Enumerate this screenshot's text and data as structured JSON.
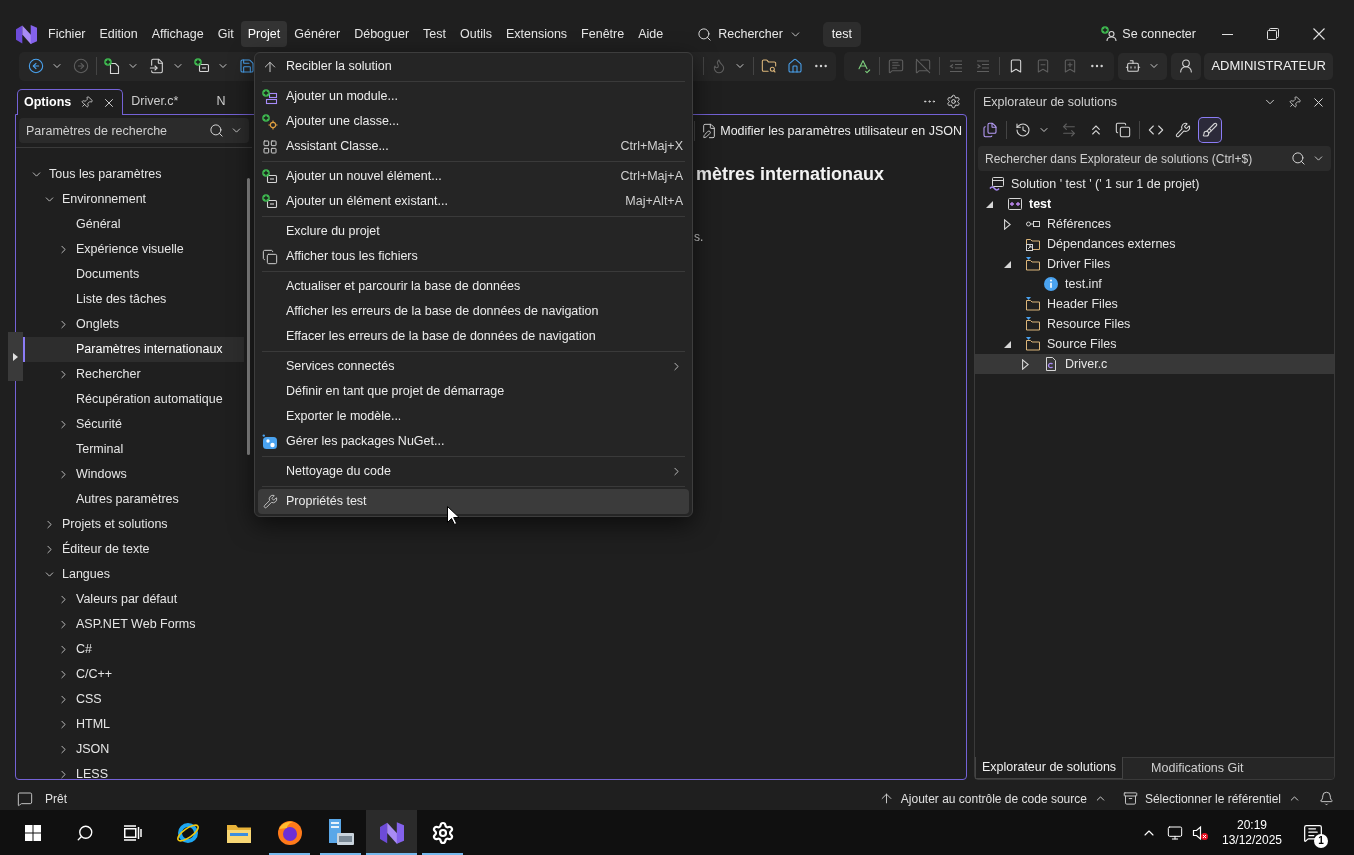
{
  "title_bar": {
    "menu": [
      {
        "label": "Fichier",
        "selected": false
      },
      {
        "label": "Edition",
        "selected": false
      },
      {
        "label": "Affichage",
        "selected": false
      },
      {
        "label": "Git",
        "selected": false
      },
      {
        "label": "Projet",
        "selected": true
      },
      {
        "label": "Générer",
        "selected": false
      },
      {
        "label": "Déboguer",
        "selected": false
      },
      {
        "label": "Test",
        "selected": false
      },
      {
        "label": "Outils",
        "selected": false
      },
      {
        "label": "Extensions",
        "selected": false
      },
      {
        "label": "Fenêtre",
        "selected": false
      },
      {
        "label": "Aide",
        "selected": false
      }
    ],
    "search_button": "Rechercher",
    "solution_badge": "test",
    "sign_in": "Se connecter"
  },
  "toolbar": {
    "main_group": {
      "start": [
        [
          {
            "kind": "back",
            "disabled": false,
            "dropdown": true
          },
          {
            "kind": "forward",
            "disabled": true
          }
        ],
        [
          {
            "kind": "new-project",
            "disabled": false,
            "dropdown": true
          },
          {
            "kind": "open-file",
            "disabled": false,
            "dropdown": true
          },
          {
            "kind": "add-item",
            "disabled": false,
            "dropdown": true
          },
          {
            "kind": "save",
            "disabled": false
          }
        ]
      ],
      "end": [
        [
          {
            "kind": "flame",
            "disabled": true,
            "dropdown": true
          }
        ],
        [
          {
            "kind": "folder-search",
            "disabled": false
          },
          {
            "kind": "home-window",
            "disabled": false
          },
          {
            "kind": "more",
            "disabled": false
          }
        ]
      ]
    },
    "edit_group": [
      [
        {
          "kind": "spell-check",
          "disabled": false
        }
      ],
      [
        {
          "kind": "comment",
          "disabled": true
        },
        {
          "kind": "uncomment",
          "disabled": true
        }
      ],
      [
        {
          "kind": "outdent",
          "disabled": true
        },
        {
          "kind": "indent",
          "disabled": true
        }
      ],
      [
        {
          "kind": "bookmark",
          "disabled": false
        },
        {
          "kind": "bookmark-prev",
          "disabled": true
        },
        {
          "kind": "bookmark-next",
          "disabled": true
        },
        {
          "kind": "more",
          "disabled": false
        }
      ]
    ],
    "extras": [
      {
        "kind": "assistant",
        "dropdown": true
      },
      {
        "kind": "share"
      }
    ],
    "account_button": "ADMINISTRATEUR"
  },
  "options_window": {
    "tabs": [
      {
        "label": "Options",
        "selected": true
      },
      {
        "label": "Driver.c*",
        "selected": false
      },
      {
        "label": "N",
        "selected": false
      }
    ],
    "search": {
      "placeholder": "Paramètres de recherche"
    },
    "tree": [
      {
        "label": "Tous les paramètres",
        "expanded": true,
        "selected": false,
        "children": [
          {
            "label": "Environnement",
            "expanded": true,
            "selected": false,
            "children": [
              {
                "label": "Général",
                "selected": false
              },
              {
                "label": "Expérience visuelle",
                "expanded": false,
                "selected": false
              },
              {
                "label": "Documents",
                "selected": false
              },
              {
                "label": "Liste des tâches",
                "selected": false
              },
              {
                "label": "Onglets",
                "expanded": false,
                "selected": false
              },
              {
                "label": "Paramètres internationaux",
                "selected": true
              },
              {
                "label": "Rechercher",
                "expanded": false,
                "selected": false
              },
              {
                "label": "Récupération automatique",
                "selected": false
              },
              {
                "label": "Sécurité",
                "expanded": false,
                "selected": false
              },
              {
                "label": "Terminal",
                "selected": false
              },
              {
                "label": "Windows",
                "expanded": false,
                "selected": false
              },
              {
                "label": "Autres paramètres",
                "selected": false
              }
            ]
          },
          {
            "label": "Projets et solutions",
            "expanded": false,
            "selected": false
          },
          {
            "label": "Éditeur de texte",
            "expanded": false,
            "selected": false
          },
          {
            "label": "Langues",
            "expanded": true,
            "selected": false,
            "children": [
              {
                "label": "Valeurs par défaut",
                "expanded": false,
                "selected": false
              },
              {
                "label": "ASP.NET Web Forms",
                "expanded": false,
                "selected": false
              },
              {
                "label": "C#",
                "expanded": false,
                "selected": false
              },
              {
                "label": "C/C++",
                "expanded": false,
                "selected": false
              },
              {
                "label": "CSS",
                "expanded": false,
                "selected": false
              },
              {
                "label": "HTML",
                "expanded": false,
                "selected": false
              },
              {
                "label": "JSON",
                "expanded": false,
                "selected": false
              },
              {
                "label": "LESS",
                "expanded": false,
                "selected": false
              }
            ]
          }
        ]
      }
    ],
    "json_button": "Modifier les paramètres utilisateur en JSON",
    "heading": "mètres internationaux",
    "description": "s."
  },
  "project_menu": {
    "groups": [
      [
        {
          "label": "Recibler la solution",
          "submenu": false,
          "highlighted": false
        }
      ],
      [
        {
          "label": "Ajouter un module...",
          "submenu": false,
          "highlighted": false
        },
        {
          "label": "Ajouter une classe...",
          "submenu": false,
          "highlighted": false
        },
        {
          "label": "Assistant Classe...",
          "shortcut": "Ctrl+Maj+X",
          "submenu": false,
          "highlighted": false
        }
      ],
      [
        {
          "label": "Ajouter un nouvel élément...",
          "shortcut": "Ctrl+Maj+A",
          "submenu": false,
          "highlighted": false
        },
        {
          "label": "Ajouter un élément existant...",
          "shortcut": "Maj+Alt+A",
          "submenu": false,
          "highlighted": false
        }
      ],
      [
        {
          "label": "Exclure du projet",
          "submenu": false,
          "highlighted": false
        },
        {
          "label": "Afficher tous les fichiers",
          "submenu": false,
          "highlighted": false
        }
      ],
      [
        {
          "label": "Actualiser et parcourir la base de données",
          "submenu": false,
          "highlighted": false
        },
        {
          "label": "Afficher les erreurs de la base de données de navigation",
          "submenu": false,
          "highlighted": false
        },
        {
          "label": "Effacer les erreurs de la base de données de navigation",
          "submenu": false,
          "highlighted": false
        }
      ],
      [
        {
          "label": "Services connectés",
          "submenu": true,
          "highlighted": false
        },
        {
          "label": "Définir en tant que projet de démarrage",
          "submenu": false,
          "highlighted": false
        },
        {
          "label": "Exporter le modèle...",
          "submenu": false,
          "highlighted": false
        },
        {
          "label": "Gérer les packages NuGet...",
          "submenu": false,
          "highlighted": false
        }
      ],
      [
        {
          "label": "Nettoyage du code",
          "submenu": true,
          "highlighted": false
        }
      ],
      [
        {
          "label": "Propriétés test",
          "submenu": false,
          "highlighted": true
        }
      ]
    ]
  },
  "solution_explorer": {
    "title": "Explorateur de solutions",
    "toolbar": [
      [
        {
          "kind": "switch-views",
          "disabled": false,
          "selected": false
        }
      ],
      [
        {
          "kind": "history",
          "disabled": false,
          "selected": false,
          "dropdown": true
        },
        {
          "kind": "sync",
          "disabled": true,
          "selected": false
        },
        {
          "kind": "collapse-all",
          "disabled": false,
          "selected": false
        },
        {
          "kind": "show-all-files",
          "disabled": false,
          "selected": false
        }
      ],
      [
        {
          "kind": "code",
          "disabled": false,
          "selected": false
        },
        {
          "kind": "properties",
          "disabled": false,
          "selected": false
        },
        {
          "kind": "preview",
          "disabled": false,
          "selected": true
        }
      ]
    ],
    "search": {
      "placeholder": "Rechercher dans Explorateur de solutions (Ctrl+$)"
    },
    "tree": [
      {
        "kind": "solution",
        "label": "Solution ' test ' (' 1 sur 1 de projet)",
        "selected": false,
        "children": [
          {
            "kind": "project",
            "label": "test",
            "expanded": true,
            "selected": false,
            "children": [
              {
                "kind": "references",
                "label": "Références",
                "expanded": false,
                "selected": false
              },
              {
                "kind": "external",
                "label": "Dépendances externes",
                "selected": false
              },
              {
                "kind": "folder",
                "label": "Driver Files",
                "expanded": true,
                "selected": false,
                "children": [
                  {
                    "kind": "info",
                    "label": "test.inf",
                    "selected": false
                  }
                ]
              },
              {
                "kind": "folder",
                "label": "Header Files",
                "selected": false
              },
              {
                "kind": "folder",
                "label": "Resource Files",
                "selected": false
              },
              {
                "kind": "folder",
                "label": "Source Files",
                "expanded": true,
                "selected": false,
                "children": [
                  {
                    "kind": "code-file",
                    "label": "Driver.c",
                    "expanded": false,
                    "selected": true
                  }
                ]
              }
            ]
          }
        ]
      }
    ],
    "tabs": [
      {
        "label": "Explorateur de solutions",
        "selected": true
      },
      {
        "label": "Modifications Git",
        "selected": false
      }
    ]
  },
  "status_bar": {
    "message": "Prêt",
    "source_control": "Ajouter au contrôle de code source",
    "repository": "Sélectionner le référentiel"
  },
  "taskbar": {
    "apps": [
      {
        "kind": "globe",
        "running": false,
        "active": false
      },
      {
        "kind": "folder",
        "running": false,
        "active": false
      },
      {
        "kind": "fox",
        "running": true,
        "active": false
      },
      {
        "kind": "server",
        "running": true,
        "active": false
      },
      {
        "kind": "ide",
        "running": true,
        "active": true
      },
      {
        "kind": "gear",
        "running": true,
        "active": false
      }
    ],
    "time": "20:19",
    "date": "13/12/2025",
    "notification_count": "1"
  }
}
